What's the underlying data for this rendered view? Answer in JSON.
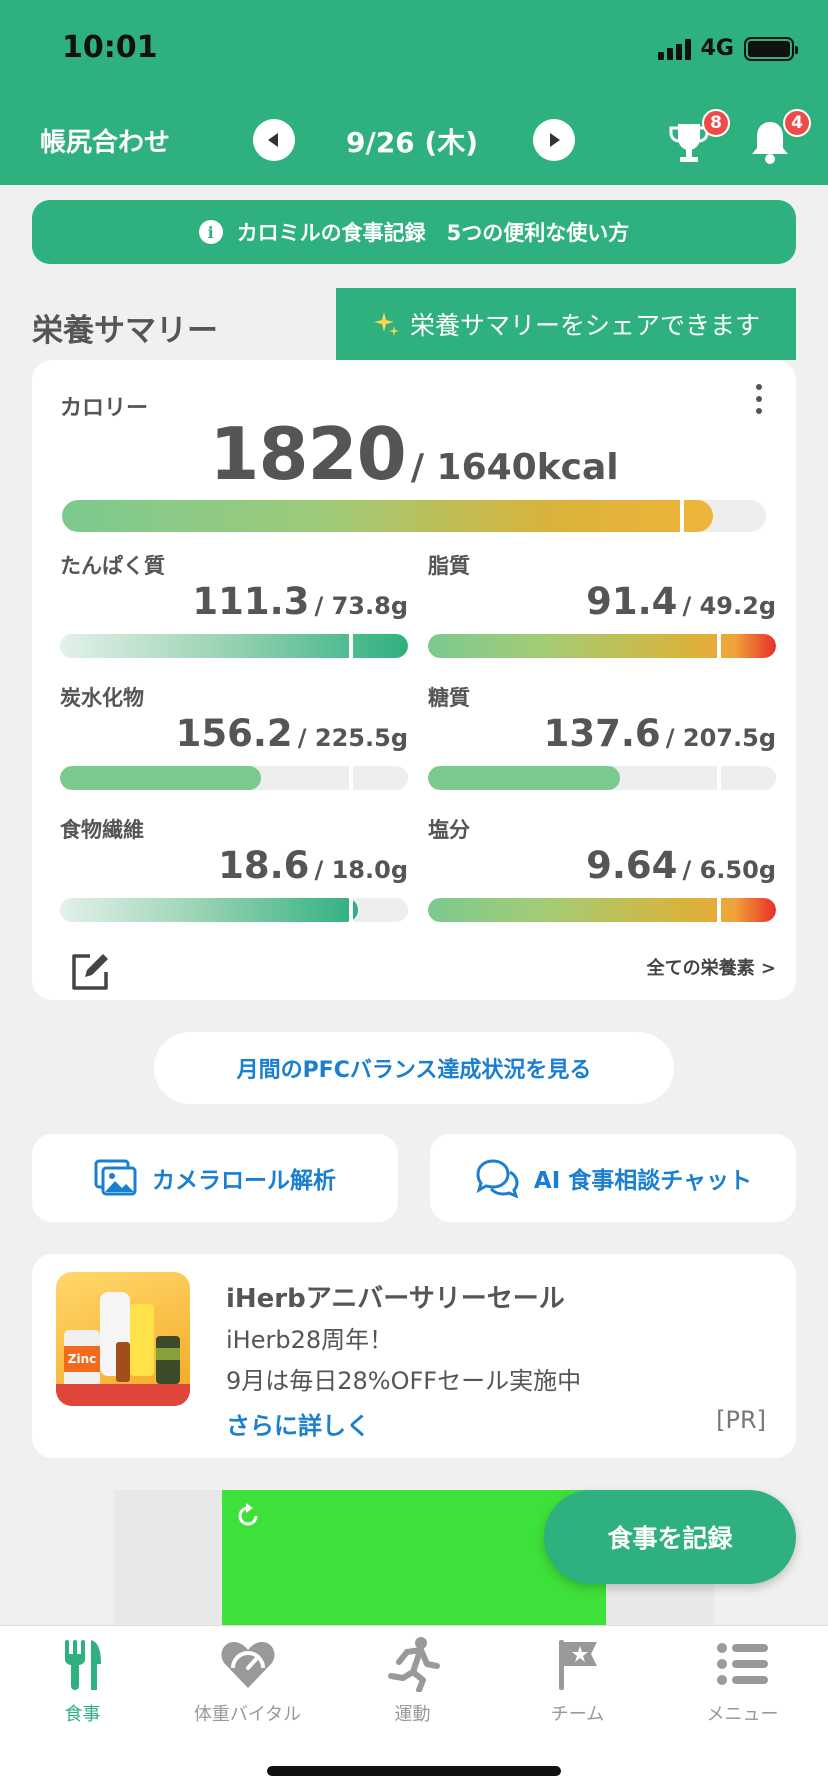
{
  "status": {
    "time": "10:01",
    "network": "4G"
  },
  "header": {
    "left_label": "帳尻合わせ",
    "date": "9/26 (木)",
    "trophy_badge": "8",
    "bell_badge": "4"
  },
  "info_banner": {
    "label": "カロミルの食事記録　5つの便利な使い方"
  },
  "summary": {
    "title": "栄養サマリー",
    "share_tip": "栄養サマリーをシェアできます",
    "calorie": {
      "label": "カロリー",
      "value": "1820",
      "target": "/ 1640kcal",
      "progress": 0.925
    },
    "nutrients": [
      {
        "label": "たんぱく質",
        "value": "111.3",
        "target": "/ 73.8g",
        "progress": 1.0,
        "style": "green-grad"
      },
      {
        "label": "脂質",
        "value": "91.4",
        "target": "/ 49.2g",
        "progress": 1.0,
        "style": "warn"
      },
      {
        "label": "炭水化物",
        "value": "156.2",
        "target": "/ 225.5g",
        "progress": 0.577,
        "style": "green"
      },
      {
        "label": "糖質",
        "value": "137.6",
        "target": "/ 207.5g",
        "progress": 0.552,
        "style": "green"
      },
      {
        "label": "食物繊維",
        "value": "18.6",
        "target": "/ 18.0g",
        "progress": 0.855,
        "style": "green-grad"
      },
      {
        "label": "塩分",
        "value": "9.64",
        "target": "/ 6.50g",
        "progress": 1.0,
        "style": "warn"
      }
    ],
    "all_nutrients_link": "全ての栄養素 >"
  },
  "pfc_button": "月間のPFCバランス達成状況を見る",
  "actions": {
    "camera_roll": "カメラロール解析",
    "ai_chat": "AI 食事相談チャット"
  },
  "ad": {
    "title": "iHerbアニバーサリーセール",
    "line1": "iHerb28周年！",
    "line2": "9月は毎日28%OFFセール実施中",
    "more": "さらに詳しく",
    "pr": "[PR]",
    "product_label": "Zinc"
  },
  "fab_label": "食事を記録",
  "tabs": [
    {
      "label": "食事",
      "icon": "fork-knife-icon",
      "active": true
    },
    {
      "label": "体重バイタル",
      "icon": "heart-gauge-icon",
      "active": false
    },
    {
      "label": "運動",
      "icon": "runner-icon",
      "active": false
    },
    {
      "label": "チーム",
      "icon": "flag-icon",
      "active": false
    },
    {
      "label": "メニュー",
      "icon": "menu-icon",
      "active": false
    }
  ],
  "colors": {
    "brand": "#2eb07f",
    "link": "#1a7fd0",
    "badge": "#f04b4b"
  }
}
